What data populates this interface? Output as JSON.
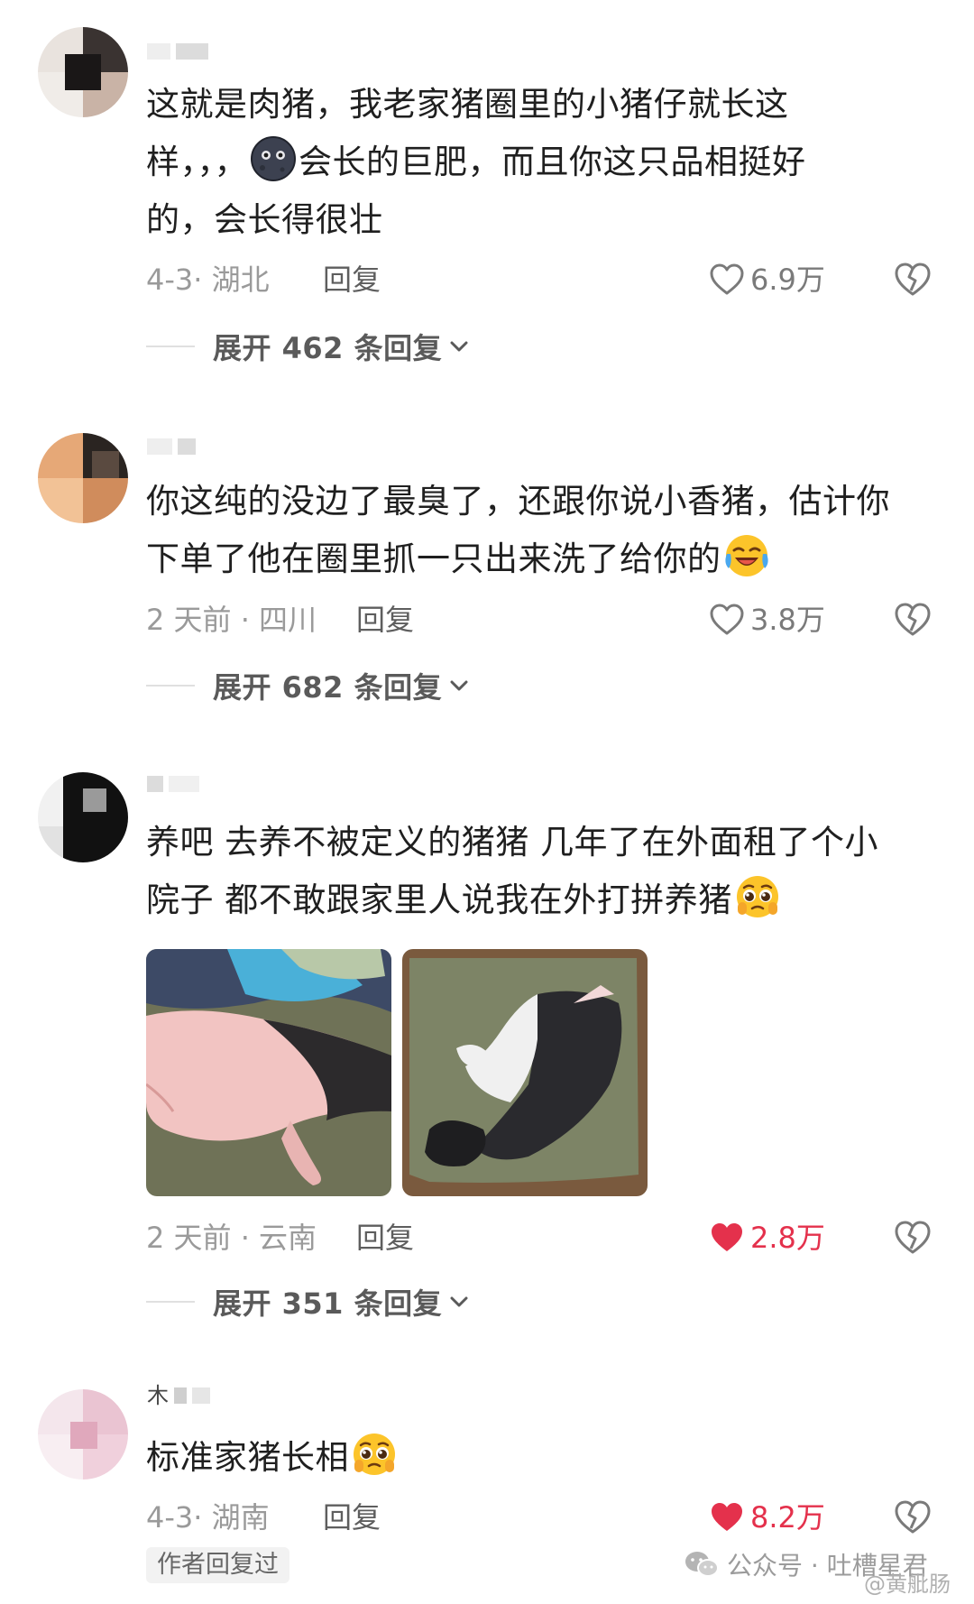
{
  "comments": [
    {
      "text_line1": "这就是肉猪，我老家猪圈里的小猪仔就长这",
      "text_line2a": "样，，，",
      "text_line2b": "会长的巨肥，而且你这只品相挺好",
      "text_line3": "的，会长得很壮",
      "emoji": "dark-moon-face-icon",
      "time_location": "4-3· 湖北",
      "reply_label": "回复",
      "likes": "6.9万",
      "liked": false,
      "expand_label": "展开 462 条回复"
    },
    {
      "text_line1": "你这纯的没边了最臭了，还跟你说小香猪，估计你",
      "text_line2": "下单了他在圈里抓一只出来洗了给你的",
      "emoji": "crying-laughing-face-icon",
      "time_location": "2 天前 · 四川",
      "reply_label": "回复",
      "likes": "3.8万",
      "liked": false,
      "expand_label": "展开 682 条回复"
    },
    {
      "text_line1": "养吧 去养不被定义的猪猪 几年了在外面租了个小",
      "text_line2": "院子 都不敢跟家里人说我在外打拼养猪",
      "emoji": "pleading-face-icon",
      "photos": [
        "pink-pig-photo",
        "black-white-pig-photo"
      ],
      "time_location": "2 天前 · 云南",
      "reply_label": "回复",
      "likes": "2.8万",
      "liked": true,
      "expand_label": "展开 351 条回复"
    },
    {
      "username": "木",
      "text_line1": "标准家猪长相",
      "emoji": "pleading-face-icon",
      "time_location": "4-3· 湖南",
      "reply_label": "回复",
      "likes": "8.2万",
      "liked": true,
      "author_badge": "作者回复过"
    }
  ],
  "watermark": {
    "label": "公众号 · 吐槽星君",
    "handle": "@黄舭肠"
  },
  "colors": {
    "liked_red": "#e4314c",
    "meta_gray": "#9a9a9a",
    "text": "#1f1f1f"
  }
}
